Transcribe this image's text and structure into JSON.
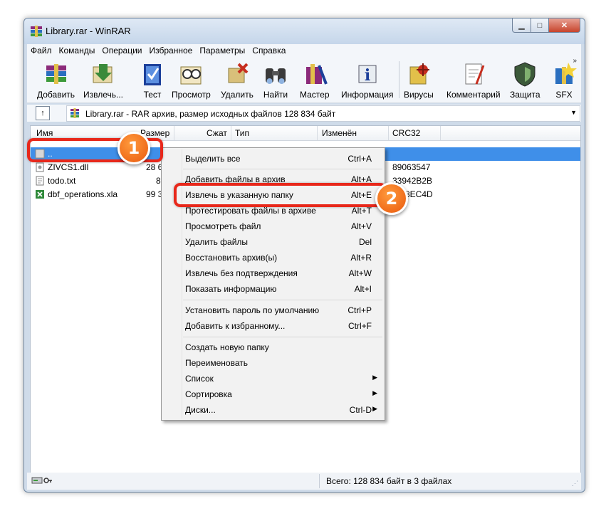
{
  "window": {
    "title": "Library.rar - WinRAR",
    "min": "▁",
    "max": "□",
    "close": "✕"
  },
  "menu": [
    "Файл",
    "Команды",
    "Операции",
    "Избранное",
    "Параметры",
    "Справка"
  ],
  "toolbar": [
    {
      "label": "Добавить",
      "icon": "add-books-icon"
    },
    {
      "label": "Извлечь...",
      "icon": "extract-icon"
    },
    {
      "label": "Тест",
      "icon": "test-icon"
    },
    {
      "label": "Просмотр",
      "icon": "view-icon"
    },
    {
      "label": "Удалить",
      "icon": "delete-icon"
    },
    {
      "label": "Найти",
      "icon": "binoculars-icon"
    },
    {
      "label": "Мастер",
      "icon": "wizard-icon"
    },
    {
      "label": "Информация",
      "icon": "info-icon"
    },
    {
      "label": "Вирусы",
      "icon": "virus-scan-icon"
    },
    {
      "label": "Комментарий",
      "icon": "comment-icon"
    },
    {
      "label": "Защита",
      "icon": "shield-icon"
    },
    {
      "label": "SFX",
      "icon": "sfx-icon"
    }
  ],
  "toolbar_more": "»",
  "path": {
    "up": "↑",
    "text": "Library.rar - RAR архив, размер исходных файлов 128 834 байт",
    "dropdown": "▼"
  },
  "columns": [
    "Имя",
    "Размер",
    "Сжат",
    "Тип",
    "Изменён",
    "CRC32"
  ],
  "files": [
    {
      "name": "..",
      "size": "",
      "crc": ""
    },
    {
      "name": "ZIVCS1.dll",
      "size": "28 6",
      "crc": "89063547"
    },
    {
      "name": "todo.txt",
      "size": "8",
      "crc": "33942B2B"
    },
    {
      "name": "dbf_operations.xla",
      "size": "99 3",
      "crc": "8EC4D"
    }
  ],
  "context_menu": [
    {
      "label": "Выделить все",
      "shortcut": "Ctrl+A"
    },
    {
      "label": "Добавить файлы в архив",
      "shortcut": "Alt+A"
    },
    {
      "label": "Извлечь в указанную папку",
      "shortcut": "Alt+E"
    },
    {
      "label": "Протестировать файлы в архиве",
      "shortcut": "Alt+T"
    },
    {
      "label": "Просмотреть файл",
      "shortcut": "Alt+V"
    },
    {
      "label": "Удалить файлы",
      "shortcut": "Del"
    },
    {
      "label": "Восстановить архив(ы)",
      "shortcut": "Alt+R"
    },
    {
      "label": "Извлечь без подтверждения",
      "shortcut": "Alt+W"
    },
    {
      "label": "Показать информацию",
      "shortcut": "Alt+I"
    },
    {
      "label": "Установить пароль по умолчанию",
      "shortcut": "Ctrl+P"
    },
    {
      "label": "Добавить к избранному...",
      "shortcut": "Ctrl+F"
    },
    {
      "label": "Создать новую папку",
      "shortcut": ""
    },
    {
      "label": "Переименовать",
      "shortcut": ""
    },
    {
      "label": "Список",
      "shortcut": "",
      "arrow": "▶"
    },
    {
      "label": "Сортировка",
      "shortcut": "",
      "arrow": "▶"
    },
    {
      "label": "Диски...",
      "shortcut": "Ctrl-D",
      "arrow": "▶"
    }
  ],
  "status": {
    "text": "Всего: 128 834 байт в 3 файлах",
    "grip": "⋰"
  },
  "badges": [
    "1",
    "2"
  ],
  "colors": {
    "selection": "#3f8fe9",
    "highlight": "#e8281b",
    "badge": "#f07a1f"
  }
}
